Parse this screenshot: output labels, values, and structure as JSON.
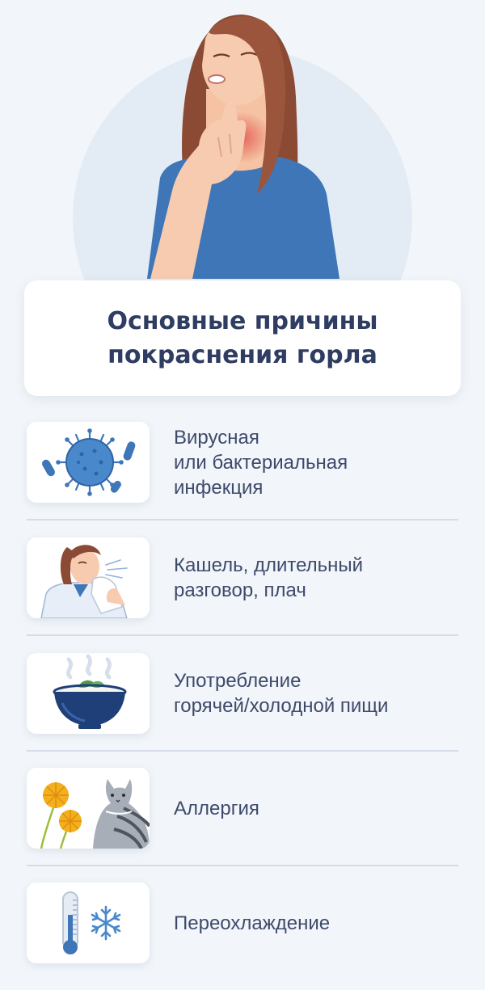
{
  "title": "Основные причины покраснения горла",
  "causes": [
    {
      "icon": "virus-bacteria-icon",
      "text": "Вирусная\nили бактериальная\nинфекция"
    },
    {
      "icon": "coughing-woman-icon",
      "text": "Кашель, длительный\nразговор, плач"
    },
    {
      "icon": "hot-food-bowl-icon",
      "text": "Употребление\nгорячей/холодной пищи"
    },
    {
      "icon": "dandelion-cat-icon",
      "text": "Аллергия"
    },
    {
      "icon": "thermometer-snowflake-icon",
      "text": "Переохлаждение"
    }
  ],
  "colors": {
    "background": "#f2f6fa",
    "title": "#2f3d63",
    "text": "#3e4a6b",
    "accent_blue": "#3f76b8",
    "divider": "#d3dce8"
  }
}
